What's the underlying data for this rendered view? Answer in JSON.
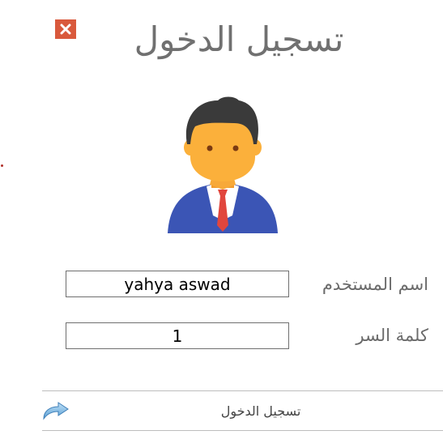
{
  "window": {
    "title": "تسجيل الدخول",
    "close_icon": "close-icon"
  },
  "avatar": {
    "icon": "user-avatar-icon"
  },
  "form": {
    "username_label": "اسم المستخدم",
    "username_value": "yahya aswad",
    "password_label": "كلمة السر",
    "password_value": "1"
  },
  "login_button": {
    "label": "تسجيل الدخول",
    "icon": "redo-arrow-icon"
  },
  "colors": {
    "close_button": "#d9593c",
    "title_text": "#707070",
    "avatar_suit": "#3b55b5",
    "avatar_skin": "#fbb03b",
    "avatar_tie": "#e1463d"
  }
}
